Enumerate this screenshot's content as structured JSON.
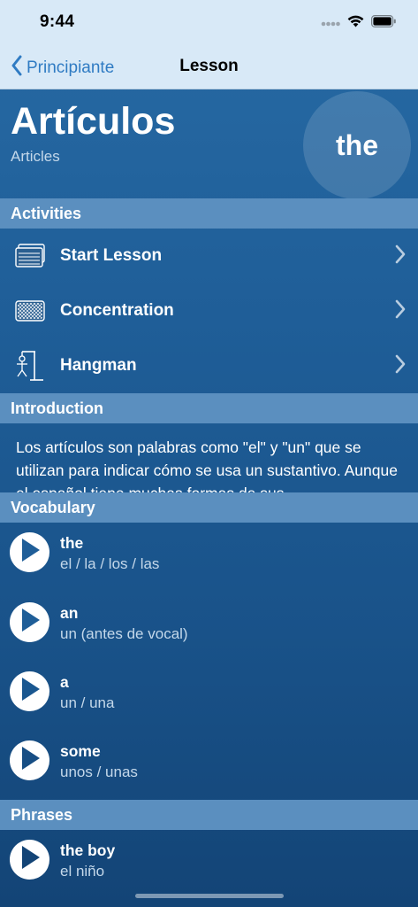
{
  "status_bar": {
    "time": "9:44"
  },
  "nav": {
    "back_label": "Principiante",
    "title": "Lesson"
  },
  "hero": {
    "title": "Artículos",
    "subtitle": "Articles",
    "badge": "the"
  },
  "sections": {
    "activities": "Activities",
    "introduction": "Introduction",
    "vocabulary": "Vocabulary",
    "phrases": "Phrases"
  },
  "activities": [
    {
      "label": "Start Lesson",
      "icon": "flashcards-icon"
    },
    {
      "label": "Concentration",
      "icon": "concentration-grid-icon"
    },
    {
      "label": "Hangman",
      "icon": "hangman-icon"
    }
  ],
  "introduction": {
    "text": "Los artículos son palabras como \"el\" y \"un\" que se utilizan para indicar cómo se usa un sustantivo. Aunque el español tiene muchas formas de sus"
  },
  "vocabulary": [
    {
      "term": "the",
      "translation": "el / la / los / las"
    },
    {
      "term": "an",
      "translation": "un (antes de vocal)"
    },
    {
      "term": "a",
      "translation": "un / una"
    },
    {
      "term": "some",
      "translation": "unos / unas"
    }
  ],
  "phrases": [
    {
      "term": "the boy",
      "translation": "el niño"
    }
  ],
  "colors": {
    "nav_background": "#d8e9f7",
    "accent": "#2f7bc3",
    "section_header": "#5b8fbf",
    "background": "#1f5e98"
  }
}
